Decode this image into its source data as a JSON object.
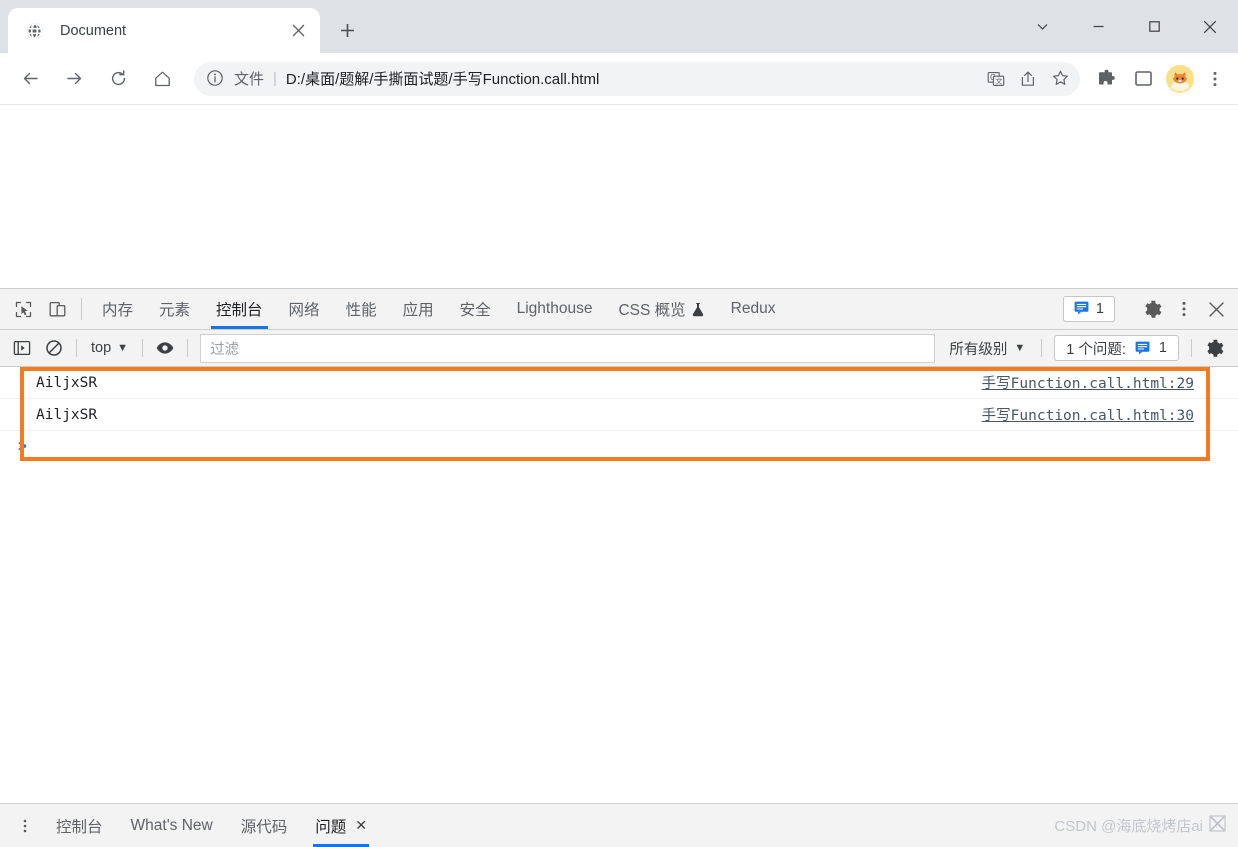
{
  "browser": {
    "tab": {
      "title": "Document",
      "favicon": "globe-icon",
      "close": "×"
    },
    "new_tab_label": "+",
    "window_controls": {
      "chevron": "chevron-down-icon",
      "minimize": "minimize-icon",
      "maximize": "maximize-icon",
      "close": "close-icon"
    },
    "nav": {
      "back": "back-arrow-icon",
      "forward": "forward-arrow-icon",
      "reload": "reload-icon",
      "home": "home-icon"
    },
    "omnibox": {
      "info_icon": "info-circle-icon",
      "scheme_label": "文件",
      "separator": "|",
      "url": "D:/桌面/题解/手撕面试题/手写Function.call.html",
      "translate_icon": "translate-icon",
      "share_icon": "share-icon",
      "bookmark_icon": "star-icon"
    },
    "toolbar_icons": {
      "extensions": "puzzle-icon",
      "side_panel": "side-panel-icon",
      "profile": "avatar-corgi",
      "menu": "kebab-menu-icon"
    }
  },
  "devtools": {
    "left_tools": {
      "inspect": "inspect-cursor-icon",
      "device": "device-toolbar-icon"
    },
    "tabs": [
      {
        "label": "内存",
        "active": false
      },
      {
        "label": "元素",
        "active": false
      },
      {
        "label": "控制台",
        "active": true
      },
      {
        "label": "网络",
        "active": false
      },
      {
        "label": "性能",
        "active": false
      },
      {
        "label": "应用",
        "active": false
      },
      {
        "label": "安全",
        "active": false
      },
      {
        "label": "Lighthouse",
        "active": false
      },
      {
        "label": "CSS 概览",
        "active": false,
        "experimental_icon": "flask-icon"
      },
      {
        "label": "Redux",
        "active": false
      }
    ],
    "message_badge": {
      "icon": "message-icon",
      "count": "1"
    },
    "settings_icon": "gear-icon",
    "more_icon": "kebab-menu-icon",
    "close_icon": "close-icon",
    "filter_bar": {
      "sidebar_toggle_icon": "console-sidebar-icon",
      "clear_icon": "clear-console-icon",
      "context": "top",
      "context_caret": "▼",
      "eye_icon": "live-expression-eye-icon",
      "filter_placeholder": "过滤",
      "level": "所有级别",
      "level_caret": "▼",
      "issues_label": "1 个问题:",
      "issues_icon": "message-icon",
      "issues_count": "1",
      "settings_icon": "gear-icon"
    },
    "console": {
      "rows": [
        {
          "message": "AiljxSR",
          "source": "手写Function.call.html:29"
        },
        {
          "message": "AiljxSR",
          "source": "手写Function.call.html:30"
        }
      ],
      "prompt_caret": ">",
      "highlight_color": "#f47b20"
    },
    "drawer": {
      "menu_icon": "kebab-menu-icon",
      "tabs": [
        {
          "label": "控制台",
          "active": false,
          "closable": false
        },
        {
          "label": "What's New",
          "active": false,
          "closable": false
        },
        {
          "label": "源代码",
          "active": false,
          "closable": false
        },
        {
          "label": "问题",
          "active": true,
          "closable": true,
          "close": "✕"
        }
      ]
    },
    "watermark": "CSDN @海底烧烤店ai"
  },
  "colors": {
    "accent": "#1a73e8",
    "highlight": "#f47b20",
    "chrome_bg": "#dee1e6",
    "panel_bg": "#f3f3f3"
  }
}
